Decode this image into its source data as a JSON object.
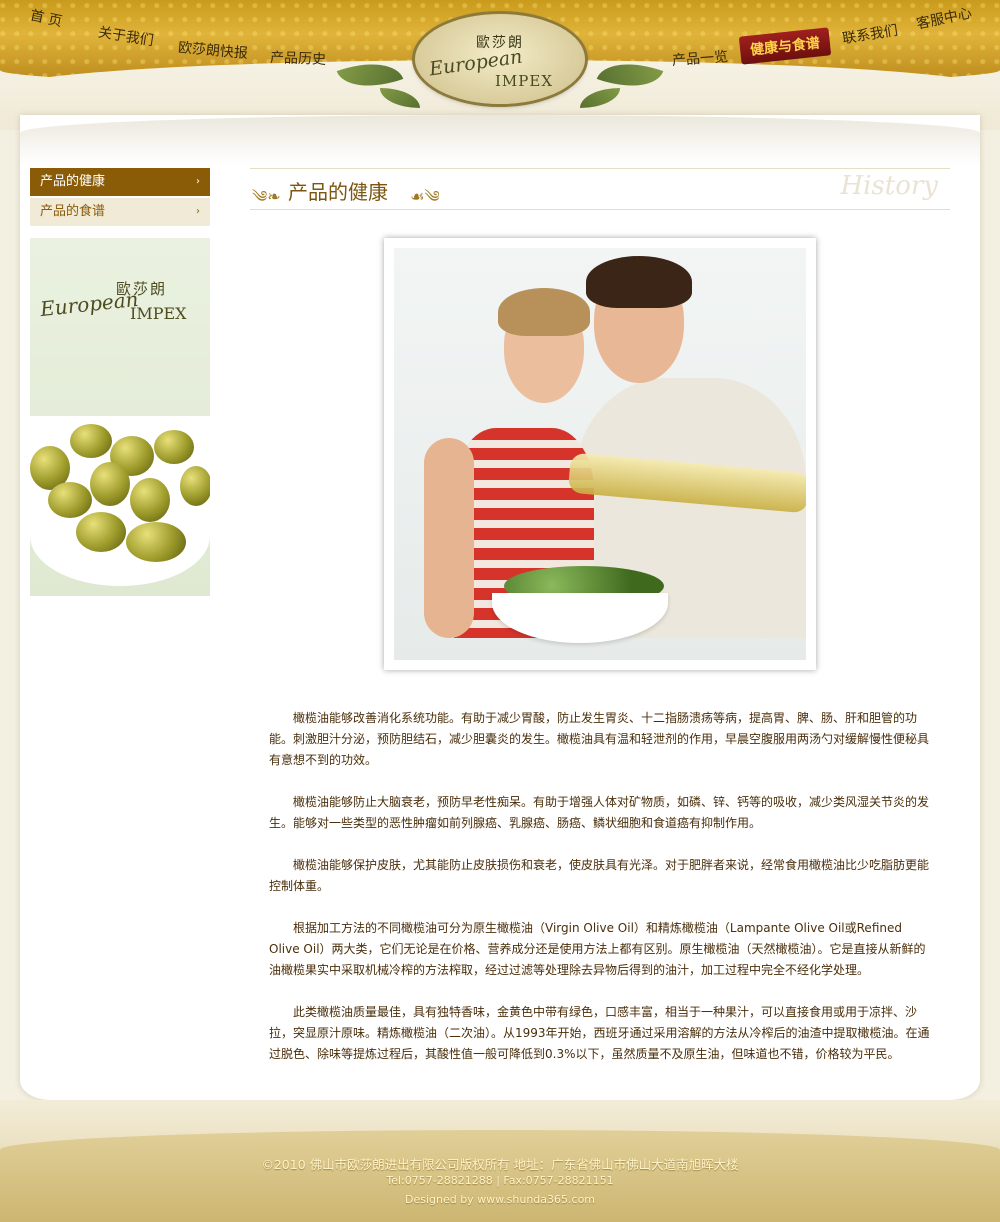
{
  "header": {
    "nav_left": [
      "首 页",
      "关于我们",
      "欧莎朗快报",
      "产品历史"
    ],
    "nav_right": [
      "产品一览",
      "健康与食谱",
      "联系我们",
      "客服中心"
    ],
    "active_nav": "健康与食谱",
    "logo_cn": "歐莎朗",
    "logo_en_1": "European",
    "logo_en_2": "IMPEX"
  },
  "sidebar": {
    "items": [
      {
        "label": "产品的健康",
        "active": true
      },
      {
        "label": "产品的食谱",
        "active": false
      }
    ],
    "chevron": "›",
    "banner": {
      "cn": "歐莎朗",
      "en_1": "European",
      "en_2": "IMPEX"
    }
  },
  "main": {
    "title": "产品的健康",
    "title_en": "History",
    "paragraphs": [
      "橄榄油能够改善消化系统功能。有助于减少胃酸，防止发生胃炎、十二指肠溃疡等病，提高胃、脾、肠、肝和胆管的功能。刺激胆汁分泌，预防胆结石，减少胆囊炎的发生。橄榄油具有温和轻泄剂的作用，早晨空腹服用两汤勺对缓解慢性便秘具有意想不到的功效。",
      "橄榄油能够防止大脑衰老，预防早老性痴呆。有助于增强人体对矿物质，如磷、锌、钙等的吸收，减少类风湿关节炎的发生。能够对一些类型的恶性肿瘤如前列腺癌、乳腺癌、肠癌、鳞状细胞和食道癌有抑制作用。",
      "橄榄油能够保护皮肤，尤其能防止皮肤损伤和衰老，使皮肤具有光泽。对于肥胖者来说，经常食用橄榄油比少吃脂肪更能控制体重。",
      "根据加工方法的不同橄榄油可分为原生橄榄油（Virgin Olive Oil）和精炼橄榄油（Lampante Olive Oil或Refined Olive Oil）两大类，它们无论是在价格、营养成分还是使用方法上都有区别。原生橄榄油（天然橄榄油）。它是直接从新鲜的油橄榄果实中采取机械冷榨的方法榨取，经过过滤等处理除去异物后得到的油汁，加工过程中完全不经化学处理。",
      "此类橄榄油质量最佳，具有独特香味，金黄色中带有绿色，口感丰富，相当于一种果汁，可以直接食用或用于凉拌、沙拉，突显原汁原味。精炼橄榄油（二次油）。从1993年开始，西班牙通过采用溶解的方法从冷榨后的油渣中提取橄榄油。在通过脱色、除味等提炼过程后，其酸性值一般可降低到0.3%以下，虽然质量不及原生油，但味道也不错，价格较为平民。"
    ]
  },
  "footer": {
    "line1": "©2010 佛山市欧莎朗进出有限公司版权所有    地址：广东省佛山市佛山大道南旭晖大楼",
    "line2": "Tel:0757-28821288 | Fax:0757-28821151",
    "line3": "Designed by www.shunda365.com"
  },
  "colors": {
    "accent": "#8a5c08",
    "header_gold": "#c99a1c",
    "active_nav_red": "#8c1a18",
    "text_brown": "#4a2e0a"
  }
}
